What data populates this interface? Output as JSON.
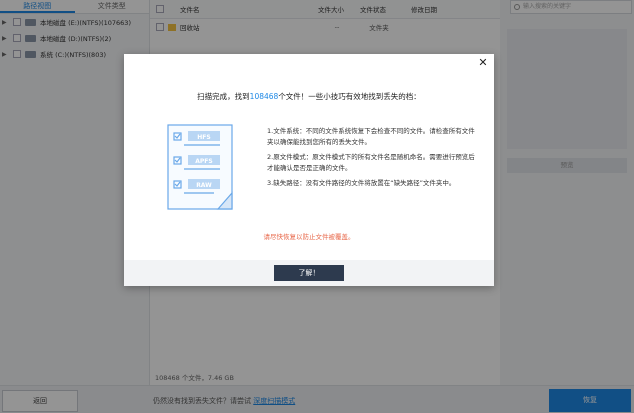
{
  "left_panel": {
    "tabs": [
      {
        "label": "路径视图",
        "active": true
      },
      {
        "label": "文件类型",
        "active": false
      }
    ],
    "drives": [
      {
        "label": "本地磁盘 (E:)(NTFS)(107663)"
      },
      {
        "label": "本地磁盘 (D:)(NTFS)(2)"
      },
      {
        "label": "系统 (C:)(NTFS)(803)"
      }
    ]
  },
  "file_list": {
    "columns": {
      "name": "文件名",
      "size": "文件大小",
      "status": "文件状态",
      "date": "修改日期"
    },
    "rows": [
      {
        "name": "回收站",
        "size": "--",
        "status": "文件夹"
      }
    ],
    "footer": "108468 个文件，7.46 GB"
  },
  "right_panel": {
    "search_placeholder": "输入搜索的关键字",
    "preview_button": "预览"
  },
  "bottom_bar": {
    "back_label": "返回",
    "message": "仍然没有找到丢失文件？请尝试",
    "deep_scan_link": "深度扫描模式",
    "recover_label": "恢复"
  },
  "modal": {
    "title_before": "扫描完成，找到",
    "title_count": "108468",
    "title_after": "个文件！一些小技巧有效地找到丢失的档：",
    "illustration_labels": [
      "HFS",
      "APFS",
      "RAW"
    ],
    "tips": [
      "1.文件系统：不同的文件系统恢复下会检查不同的文件。请检查所有文件夹以确保能找到您所有的丢失文件。",
      "2.原文件模式：原文件模式下的所有文件名是随机命名。需要进行预览后才能确认是否是正确的文件。",
      "3.缺失路径：没有文件路径的文件将放置在“缺失路径”文件夹中。"
    ],
    "warning": "请尽快恢复以防止文件被覆盖。",
    "ok_label": "了解！",
    "close_glyph": "✕"
  },
  "colors": {
    "accent": "#1e88e5",
    "warning": "#e8684a",
    "ok_button": "#2d3a4e"
  }
}
